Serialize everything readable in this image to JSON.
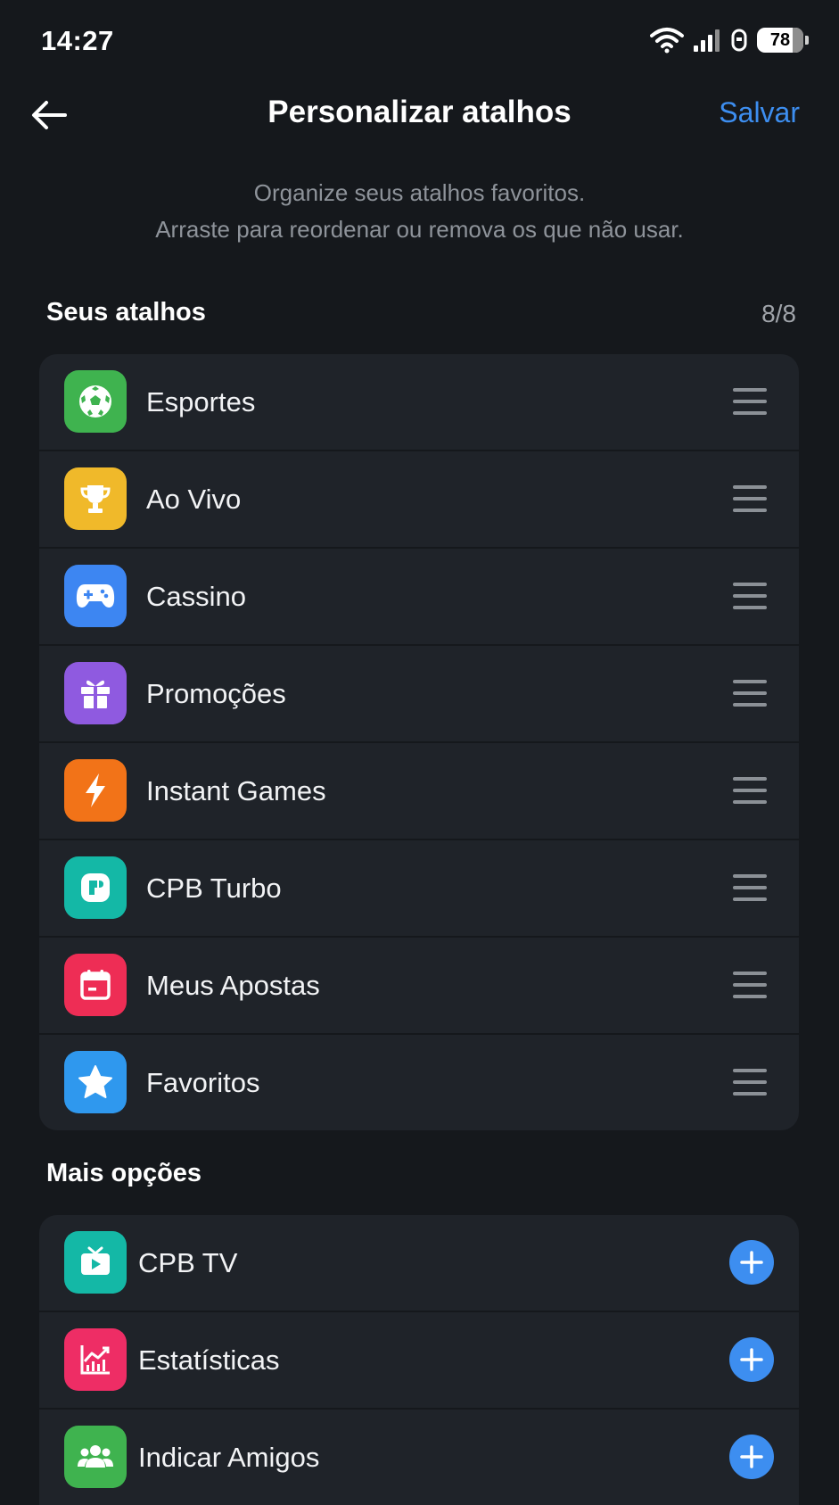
{
  "status_bar": {
    "time": "14:27",
    "battery": "78"
  },
  "header": {
    "title": "Personalizar atalhos",
    "save_label": "Salvar"
  },
  "description": {
    "line1": "Organize seus atalhos favoritos.",
    "line2": "Arraste para reordenar ou remova os que não usar."
  },
  "shortcuts": {
    "title": "Seus atalhos",
    "count": "8/8",
    "items": [
      {
        "label": "Esportes",
        "icon": "soccer-ball-icon",
        "color": "#3fb34f"
      },
      {
        "label": "Ao Vivo",
        "icon": "trophy-icon",
        "color": "#f0b92a"
      },
      {
        "label": "Cassino",
        "icon": "gamepad-icon",
        "color": "#3d86f2"
      },
      {
        "label": "Promoções",
        "icon": "gift-icon",
        "color": "#8f5ae0"
      },
      {
        "label": "Instant Games",
        "icon": "lightning-icon",
        "color": "#f27318"
      },
      {
        "label": "CPB Turbo",
        "icon": "turbo-icon",
        "color": "#14b8a6"
      },
      {
        "label": "Meus Apostas",
        "icon": "calendar-icon",
        "color": "#ee2d55"
      },
      {
        "label": "Favoritos",
        "icon": "star-icon",
        "color": "#2f98ee"
      }
    ]
  },
  "more_options": {
    "title": "Mais opções",
    "items": [
      {
        "label": "CPB TV",
        "icon": "tv-icon",
        "color": "#14b8a6"
      },
      {
        "label": "Estatísticas",
        "icon": "chart-icon",
        "color": "#ee2d65"
      },
      {
        "label": "Indicar Amigos",
        "icon": "users-icon",
        "color": "#3fb34f"
      }
    ]
  },
  "accent_color": "#3d8ef0"
}
